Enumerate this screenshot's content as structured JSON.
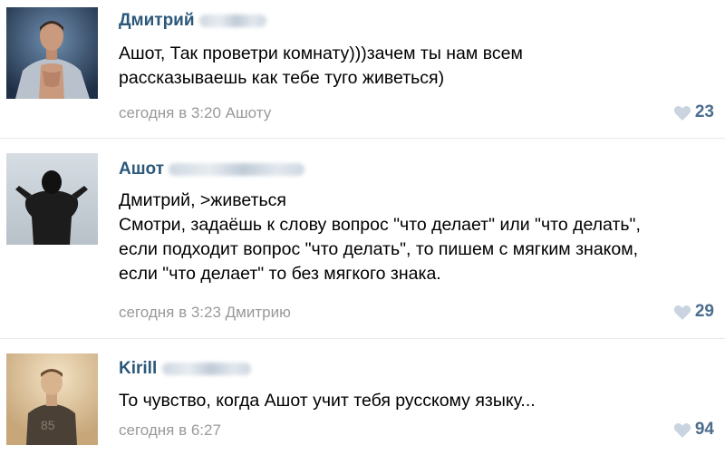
{
  "comments": [
    {
      "author_visible": "Дмитрий",
      "text": [
        "Ашот, Так проветри комнату)))зачем ты нам всем",
        "рассказываешь как тебе туго живеться)"
      ],
      "meta": "сегодня в 3:20 Ашоту",
      "likes": "23"
    },
    {
      "author_visible": "Ашот",
      "text": [
        "Дмитрий, >живеться",
        "Смотри, задаёшь к слову вопрос \"что делает\" или \"что делать\",",
        "если подходит вопрос \"что делать\", то пишем с мягким знаком,",
        "если \"что делает\" то без мягкого знака."
      ],
      "meta": "сегодня в 3:23 Дмитрию",
      "likes": "29"
    },
    {
      "author_visible": "Kirill",
      "text": [
        "То чувство, когда Ашот учит тебя русскому языку..."
      ],
      "meta": "сегодня в 6:27",
      "likes": "94"
    }
  ],
  "colors": {
    "author": "#2b587a",
    "meta": "#999999",
    "likes": "#4c6d8e",
    "divider": "#e7e8ec"
  },
  "icons": {
    "like": "heart-icon"
  }
}
